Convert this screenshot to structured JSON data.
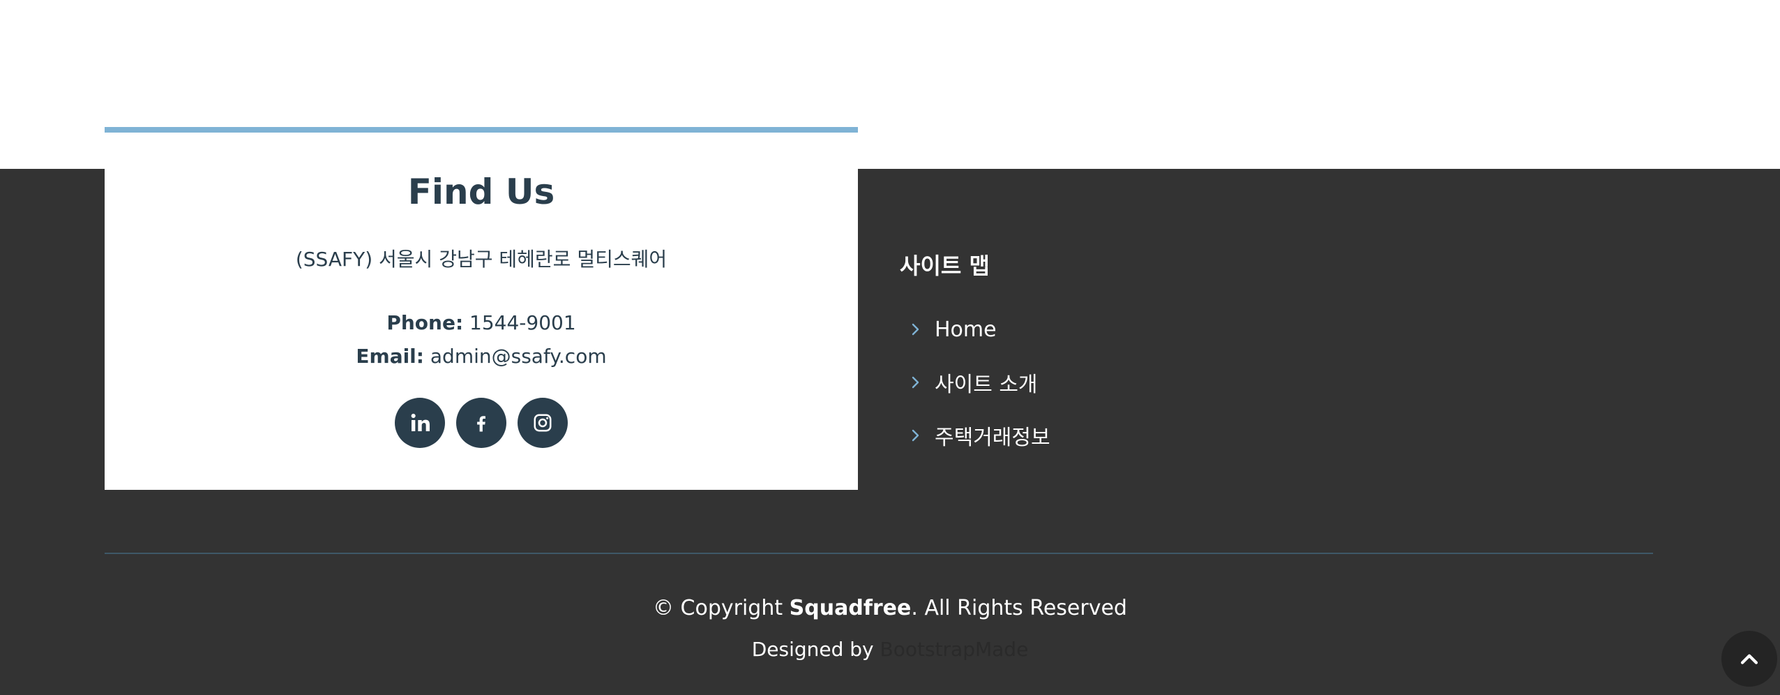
{
  "findus": {
    "title": "Find Us",
    "address": "(SSAFY) 서울시 강남구 테헤란로 멀티스퀘어",
    "phone_label": "Phone:",
    "phone_value": "1544-9001",
    "email_label": "Email:",
    "email_value": "admin@ssafy.com",
    "social": [
      {
        "icon": "linkedin-icon"
      },
      {
        "icon": "facebook-icon"
      },
      {
        "icon": "instagram-icon"
      }
    ]
  },
  "sitemap": {
    "heading": "사이트 맵",
    "links": [
      {
        "label": "Home"
      },
      {
        "label": "사이트 소개"
      },
      {
        "label": "주택거래정보"
      }
    ]
  },
  "footer": {
    "copyright_prefix": "© Copyright ",
    "copyright_brand": "Squadfree",
    "copyright_suffix": ". All Rights Reserved",
    "designed_by_prefix": "Designed by ",
    "designed_by_link": "BootstrapMade"
  },
  "colors": {
    "accent_bar": "#7fb3d5",
    "footer_bg": "#333333",
    "dark_slate": "#2a3e4c"
  },
  "back_to_top": {
    "icon": "chevron-up-icon"
  }
}
